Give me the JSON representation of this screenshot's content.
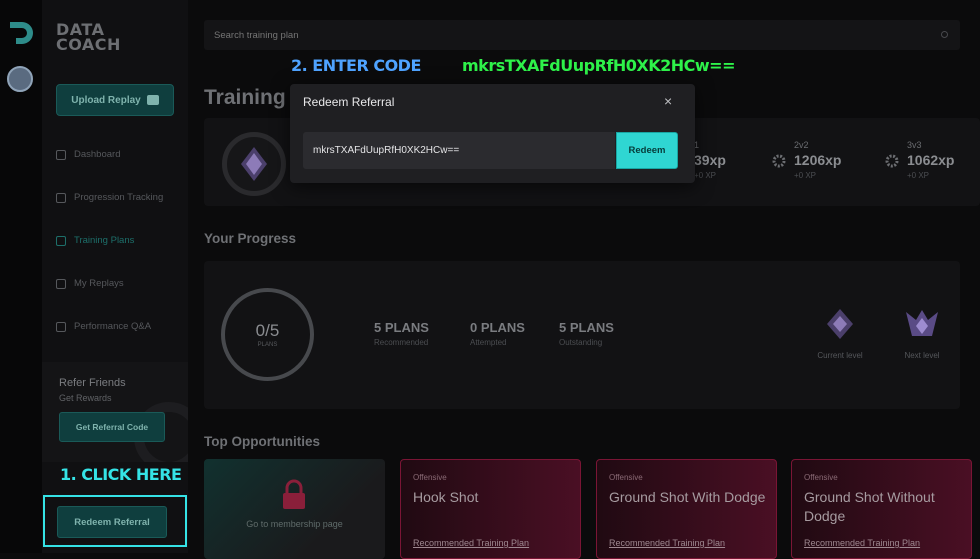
{
  "brand": {
    "line1": "DATA",
    "line2": "COACH"
  },
  "sidebar": {
    "upload_label": "Upload Replay",
    "items": [
      {
        "label": "Dashboard"
      },
      {
        "label": "Progression Tracking"
      },
      {
        "label": "Training Plans"
      },
      {
        "label": "My Replays"
      },
      {
        "label": "Performance Q&A"
      }
    ],
    "refer": {
      "title": "Refer Friends",
      "subtitle": "Get Rewards",
      "button": "Get Referral Code"
    },
    "redeem_button": "Redeem Referral"
  },
  "search": {
    "placeholder": "Search training plan"
  },
  "page": {
    "title": "Training"
  },
  "modes": [
    {
      "name": "1",
      "xp": "39xp",
      "delta": "+0 XP"
    },
    {
      "name": "2v2",
      "xp": "1206xp",
      "delta": "+0 XP"
    },
    {
      "name": "3v3",
      "xp": "1062xp",
      "delta": "+0 XP"
    }
  ],
  "progress": {
    "heading": "Your Progress",
    "ring_value": "0/5",
    "ring_label": "PLANS",
    "stats": [
      {
        "value": "5 PLANS",
        "label": "Recommended"
      },
      {
        "value": "0 PLANS",
        "label": "Attempted"
      },
      {
        "value": "5 PLANS",
        "label": "Outstanding"
      }
    ],
    "current_level": "Current level",
    "next_level": "Next level"
  },
  "opportunities": {
    "heading": "Top Opportunities",
    "locked_text": "Go to membership page",
    "cards": [
      {
        "category": "Offensive",
        "title": "Hook Shot",
        "link": "Recommended Training Plan"
      },
      {
        "category": "Offensive",
        "title": "Ground Shot With Dodge",
        "link": "Recommended Training Plan"
      },
      {
        "category": "Offensive",
        "title": "Ground Shot Without Dodge",
        "link": "Recommended Training Plan"
      }
    ]
  },
  "modal": {
    "title": "Redeem Referral",
    "code_value": "mkrsTXAFdUupRfH0XK2HCw==",
    "redeem_button": "Redeem",
    "close_symbol": "×"
  },
  "annotations": {
    "step1": "1. CLICK HERE",
    "step2": "2. ENTER CODE",
    "code_text": "mkrsTXAFdUupRfH0XK2HCw=="
  },
  "colors": {
    "accent": "#35e3e6",
    "code_green": "#2ef24a",
    "step2_blue": "#4fa3ff",
    "redeem": "#2fd6d2"
  }
}
